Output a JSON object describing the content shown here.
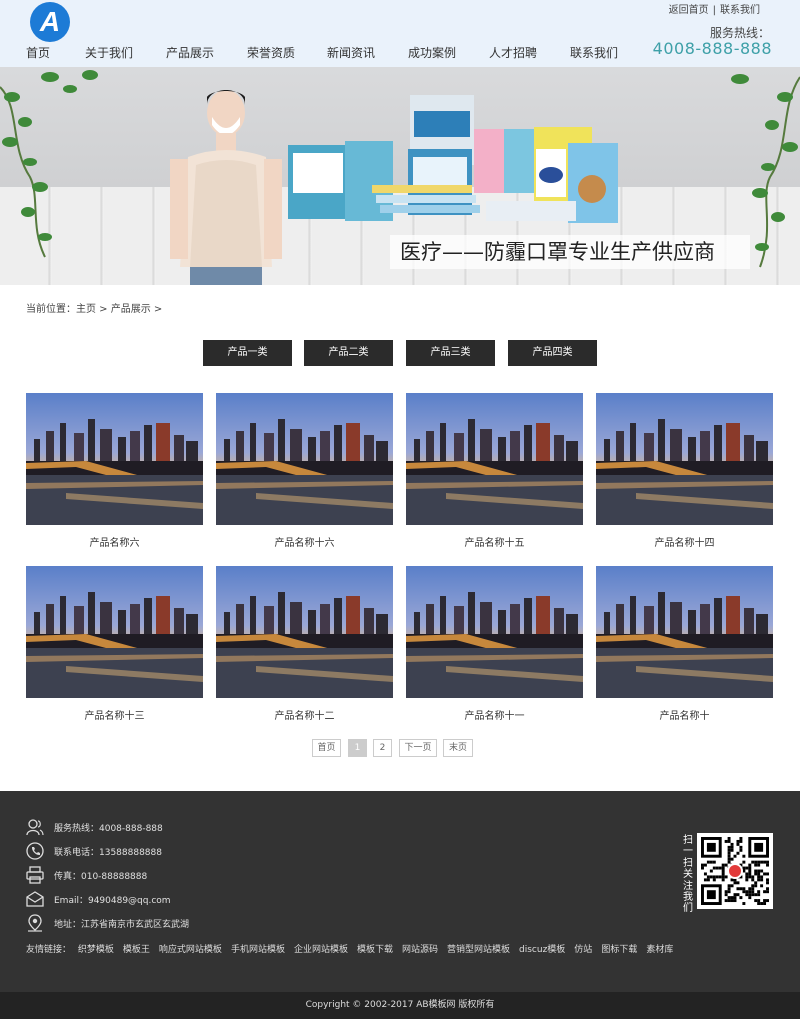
{
  "header": {
    "logo_letter": "A",
    "toplinks": [
      "返回首页",
      "联系我们"
    ],
    "toplinks_sep": "|",
    "hotline_label": "服务热线：",
    "hotline_number": "4008-888-888",
    "nav": [
      "首页",
      "关于我们",
      "产品展示",
      "荣誉资质",
      "新闻资讯",
      "成功案例",
      "人才招聘",
      "联系我们"
    ]
  },
  "banner": {
    "slogan": "医疗——防霾口罩专业生产供应商"
  },
  "breadcrumb": "当前位置：主页 > 产品展示 >",
  "categories": [
    "产品一类",
    "产品二类",
    "产品三类",
    "产品四类"
  ],
  "products": [
    "产品名称六",
    "产品名称十六",
    "产品名称十五",
    "产品名称十四",
    "产品名称十三",
    "产品名称十二",
    "产品名称十一",
    "产品名称十"
  ],
  "pagination": {
    "first": "首页",
    "pages": [
      "1",
      "2"
    ],
    "current": "1",
    "next": "下一页",
    "last": "末页"
  },
  "footer": {
    "contacts": [
      {
        "icon": "user-icon",
        "text": "服务热线：4008-888-888"
      },
      {
        "icon": "phone-icon",
        "text": "联系电话：13588888888"
      },
      {
        "icon": "printer-icon",
        "text": "传真：010-88888888"
      },
      {
        "icon": "mail-icon",
        "text": "Email：9490489@qq.com"
      },
      {
        "icon": "location-icon",
        "text": "地址：江苏省南京市玄武区玄武湖"
      }
    ],
    "friend_links_label": "友情链接：",
    "friend_links": [
      "织梦模板",
      "模板王",
      "响应式网站模板",
      "手机网站模板",
      "企业网站模板",
      "模板下载",
      "网站源码",
      "营销型网站模板",
      "discuz模板",
      "仿站",
      "图标下载",
      "素材库"
    ],
    "qr_caption": "扫一扫关注我们",
    "copyright": "Copyright © 2002-2017 AB模板网 版权所有"
  }
}
